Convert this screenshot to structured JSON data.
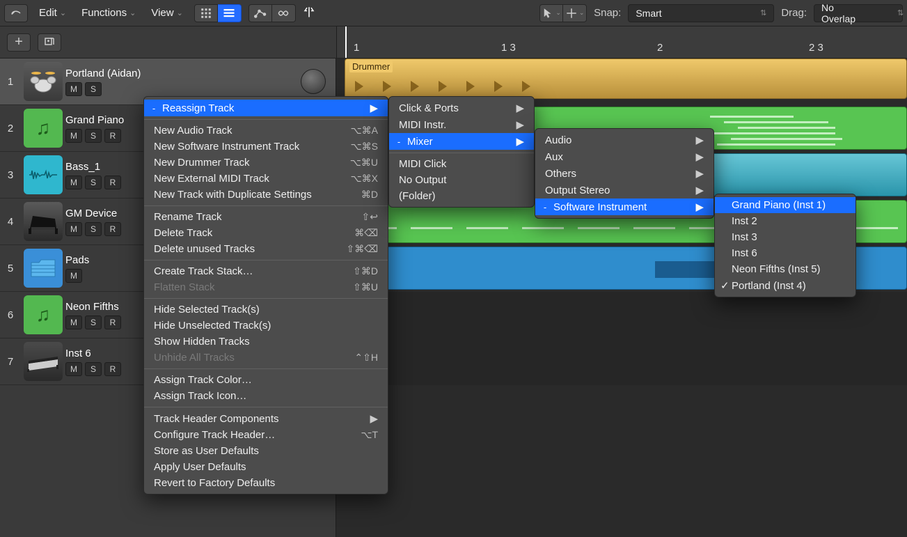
{
  "toolbar": {
    "edit": "Edit",
    "functions": "Functions",
    "view": "View",
    "snap_label": "Snap:",
    "snap_value": "Smart",
    "drag_label": "Drag:",
    "drag_value": "No Overlap"
  },
  "ruler": {
    "m1": "1",
    "m13": "1 3",
    "m2": "2",
    "m23": "2 3"
  },
  "tracks": [
    {
      "num": "1",
      "name": "Portland (Aidan)",
      "m": "M",
      "s": "S",
      "r": "",
      "icon": "drum",
      "selected": true
    },
    {
      "num": "2",
      "name": "Grand Piano",
      "m": "M",
      "s": "S",
      "r": "R",
      "icon": "green"
    },
    {
      "num": "3",
      "name": "Bass_1",
      "m": "M",
      "s": "S",
      "r": "R",
      "icon": "cyan"
    },
    {
      "num": "4",
      "name": "GM Device",
      "m": "M",
      "s": "S",
      "r": "R",
      "icon": "piano"
    },
    {
      "num": "5",
      "name": "Pads",
      "m": "M",
      "s": "",
      "r": "",
      "icon": "blue"
    },
    {
      "num": "6",
      "name": "Neon Fifths",
      "m": "M",
      "s": "S",
      "r": "R",
      "icon": "green"
    },
    {
      "num": "7",
      "name": "Inst 6",
      "m": "M",
      "s": "S",
      "r": "R",
      "icon": "keys"
    }
  ],
  "regions": {
    "drummer_label": "Drummer"
  },
  "menu1": {
    "reassign": "Reassign Track",
    "new_audio": "New Audio Track",
    "sc_new_audio": "⌥⌘A",
    "new_si": "New Software Instrument Track",
    "sc_new_si": "⌥⌘S",
    "new_drummer": "New Drummer Track",
    "sc_new_drummer": "⌥⌘U",
    "new_ext_midi": "New External MIDI Track",
    "sc_new_ext_midi": "⌥⌘X",
    "new_dup": "New Track with Duplicate Settings",
    "sc_new_dup": "⌘D",
    "rename": "Rename Track",
    "sc_rename": "⇧↩",
    "delete": "Delete Track",
    "sc_delete": "⌘⌫",
    "delete_unused": "Delete unused Tracks",
    "sc_delete_unused": "⇧⌘⌫",
    "create_stack": "Create Track Stack…",
    "sc_create_stack": "⇧⌘D",
    "flatten_stack": "Flatten Stack",
    "sc_flatten_stack": "⇧⌘U",
    "hide_sel": "Hide Selected Track(s)",
    "hide_unsel": "Hide Unselected Track(s)",
    "show_hidden": "Show Hidden Tracks",
    "unhide_all": "Unhide All Tracks",
    "sc_unhide_all": "⌃⇧H",
    "assign_color": "Assign Track Color…",
    "assign_icon": "Assign Track Icon…",
    "header_comp": "Track Header Components",
    "config_header": "Configure Track Header…",
    "sc_config_header": "⌥T",
    "store_defaults": "Store as User Defaults",
    "apply_defaults": "Apply User Defaults",
    "revert_factory": "Revert to Factory Defaults"
  },
  "menu2": {
    "click_ports": "Click & Ports",
    "midi_instr": "MIDI Instr.",
    "mixer": "Mixer",
    "midi_click": "MIDI Click",
    "no_output": "No Output",
    "folder": "(Folder)"
  },
  "menu3": {
    "audio": "Audio",
    "aux": "Aux",
    "others": "Others",
    "output_stereo": "Output Stereo",
    "software_instrument": "Software Instrument"
  },
  "menu4": {
    "grand_piano": "Grand Piano (Inst 1)",
    "inst2": "Inst 2",
    "inst3": "Inst 3",
    "inst6": "Inst 6",
    "neon_fifths": "Neon Fifths (Inst 5)",
    "portland": "Portland (Inst 4)"
  }
}
